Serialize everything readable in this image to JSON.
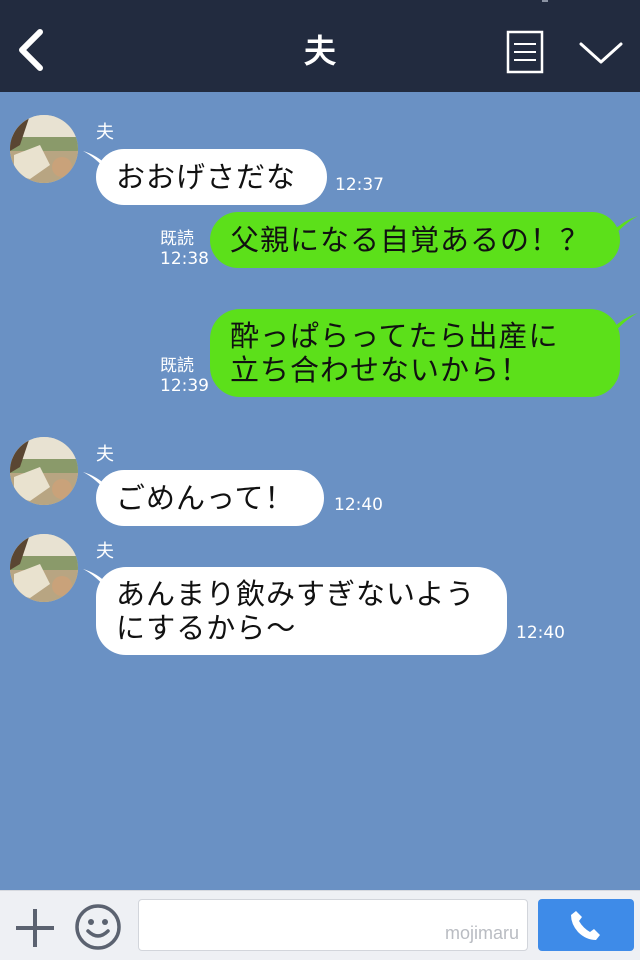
{
  "header": {
    "title": "夫",
    "back_icon": "chevron-left-icon",
    "menu_icon": "notes-icon",
    "collapse_icon": "chevron-down-icon"
  },
  "messages": [
    {
      "direction": "in",
      "sender": "夫",
      "lines": [
        "おおげさだな"
      ],
      "time": "12:37"
    },
    {
      "direction": "out",
      "lines": [
        "父親になる自覚あるの！？"
      ],
      "read": "既読",
      "time": "12:38"
    },
    {
      "direction": "out",
      "lines": [
        "酔っぱらってたら出産に",
        "立ち合わせないから！"
      ],
      "read": "既読",
      "time": "12:39"
    },
    {
      "direction": "in",
      "sender": "夫",
      "lines": [
        "ごめんって！"
      ],
      "time": "12:40"
    },
    {
      "direction": "in",
      "sender": "夫",
      "lines": [
        "あんまり飲みすぎないよう",
        "にするから〜"
      ],
      "time": "12:40"
    }
  ],
  "input": {
    "placeholder": "",
    "watermark": "mojimaru",
    "plus_icon": "plus-icon",
    "emoji_icon": "smiley-icon",
    "call_icon": "phone-icon"
  },
  "colors": {
    "header_bg": "#222b3f",
    "chat_bg": "#6a91c4",
    "bubble_out": "#5ce01a",
    "bubble_in": "#ffffff",
    "call_button": "#3e8be8"
  }
}
